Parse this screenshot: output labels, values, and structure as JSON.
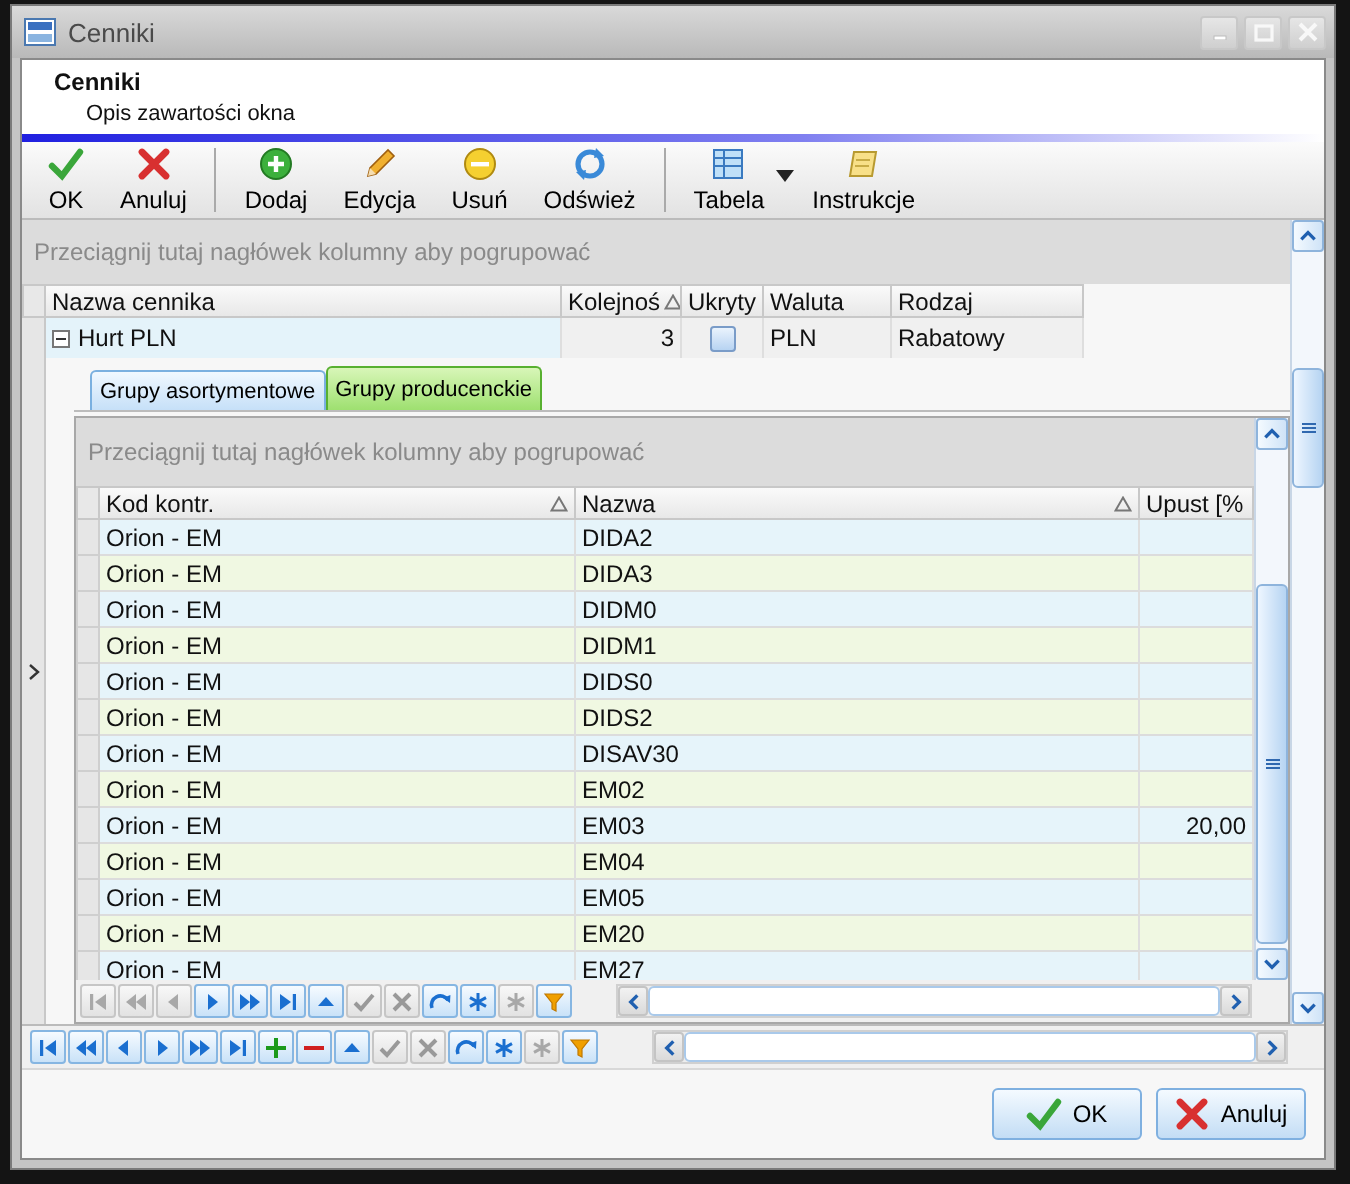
{
  "window": {
    "title": "Cenniki"
  },
  "header": {
    "title": "Cenniki",
    "description": "Opis zawartości okna"
  },
  "toolbar": [
    {
      "buttons": [
        {
          "kind": "ok",
          "label": "OK",
          "dropdown": false
        },
        {
          "kind": "cancel",
          "label": "Anuluj",
          "dropdown": false
        }
      ]
    },
    {
      "buttons": [
        {
          "kind": "add",
          "label": "Dodaj",
          "dropdown": false
        },
        {
          "kind": "edit",
          "label": "Edycja",
          "dropdown": false
        },
        {
          "kind": "delete",
          "label": "Usuń",
          "dropdown": false
        },
        {
          "kind": "refresh",
          "label": "Odśwież",
          "dropdown": false
        }
      ]
    },
    {
      "buttons": [
        {
          "kind": "table",
          "label": "Tabela",
          "dropdown": true
        },
        {
          "kind": "instructions",
          "label": "Instrukcje",
          "dropdown": false
        }
      ]
    }
  ],
  "grid": {
    "group_hint": "Przeciągnij tutaj nagłówek kolumny aby pogrupować",
    "columns": [
      {
        "label": "Nazwa cennika",
        "sorted": false
      },
      {
        "label": "Kolejnoś",
        "sorted": true
      },
      {
        "label": "Ukryty",
        "sorted": false
      },
      {
        "label": "Waluta",
        "sorted": false
      },
      {
        "label": "Rodzaj",
        "sorted": false
      }
    ],
    "rows": [
      {
        "name": "Hurt PLN",
        "current": true,
        "expanded": true,
        "order": "3",
        "hidden": false,
        "currency": "PLN",
        "type": "Rabatowy"
      }
    ]
  },
  "detail": {
    "tabs": [
      {
        "label": "Grupy asortymentowe",
        "selected": false
      },
      {
        "label": "Grupy producenckie",
        "selected": true
      }
    ],
    "group_hint": "Przeciągnij tutaj nagłówek kolumny aby pogrupować",
    "columns": [
      {
        "label": "Kod kontr.",
        "sorted": true
      },
      {
        "label": "Nazwa",
        "sorted": true
      },
      {
        "label": "Upust [%",
        "sorted": false
      }
    ],
    "rows": [
      {
        "code": "Orion - EM",
        "name": "DIDA2"
      },
      {
        "code": "Orion - EM",
        "name": "DIDA3"
      },
      {
        "code": "Orion - EM",
        "name": "DIDM0"
      },
      {
        "code": "Orion - EM",
        "name": "DIDM1"
      },
      {
        "code": "Orion - EM",
        "name": "DIDS0"
      },
      {
        "code": "Orion - EM",
        "name": "DIDS2"
      },
      {
        "code": "Orion - EM",
        "name": "DISAV30"
      },
      {
        "code": "Orion - EM",
        "name": "EM02"
      },
      {
        "code": "Orion - EM",
        "name": "EM03",
        "discount": "20,00"
      },
      {
        "code": "Orion - EM",
        "name": "EM04"
      },
      {
        "code": "Orion - EM",
        "name": "EM05"
      },
      {
        "code": "Orion - EM",
        "name": "EM20"
      },
      {
        "code": "Orion - EM",
        "name": "EM27"
      }
    ],
    "navigator": [
      {
        "kind": "first",
        "disabled": true
      },
      {
        "kind": "prev_page",
        "disabled": true
      },
      {
        "kind": "prev",
        "disabled": true
      },
      {
        "kind": "next",
        "disabled": false
      },
      {
        "kind": "next_page",
        "disabled": false
      },
      {
        "kind": "last",
        "disabled": false
      },
      {
        "kind": "up",
        "disabled": false
      },
      {
        "kind": "confirm",
        "disabled": true
      },
      {
        "kind": "cancel",
        "disabled": true
      },
      {
        "kind": "refresh",
        "disabled": false
      },
      {
        "kind": "asterisk",
        "disabled": false
      },
      {
        "kind": "asterisk",
        "disabled": true
      },
      {
        "kind": "filter",
        "disabled": false
      }
    ]
  },
  "navigator": [
    {
      "kind": "first",
      "disabled": false
    },
    {
      "kind": "prev_page",
      "disabled": false
    },
    {
      "kind": "prev",
      "disabled": false
    },
    {
      "kind": "next",
      "disabled": false
    },
    {
      "kind": "next_page",
      "disabled": false
    },
    {
      "kind": "last",
      "disabled": false
    },
    {
      "kind": "add",
      "disabled": false
    },
    {
      "kind": "delete",
      "disabled": false
    },
    {
      "kind": "up",
      "disabled": false
    },
    {
      "kind": "confirm",
      "disabled": true
    },
    {
      "kind": "cancel",
      "disabled": true
    },
    {
      "kind": "refresh",
      "disabled": false
    },
    {
      "kind": "asterisk",
      "disabled": false
    },
    {
      "kind": "asterisk",
      "disabled": true
    },
    {
      "kind": "filter",
      "disabled": false
    }
  ],
  "footer": [
    {
      "kind": "ok",
      "label": "OK"
    },
    {
      "kind": "cancel",
      "label": "Anuluj"
    }
  ]
}
